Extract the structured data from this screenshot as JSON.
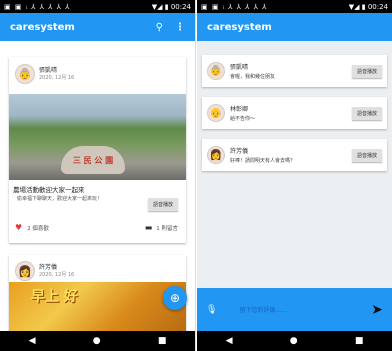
{
  "status": {
    "icons_left": "▣ ▣ ᵢ ⅄ ⅄ ⅄ ⅄ ⅄",
    "time": "00:24"
  },
  "app": {
    "title": "caresystem"
  },
  "feed": [
    {
      "user": "張凱晴",
      "date": "2020, 12月 16",
      "image_text": "三 民 公 園",
      "title": "農場活動歡迎大家一起來",
      "body": "偷幸福下聊聊天，歡迎大家一起來玩！",
      "voice_button": "語音播放",
      "likes": "2 個喜歡",
      "comments": "1 則留言"
    },
    {
      "user": "許芳儀",
      "date": "2020, 12月 16",
      "image_text": "早上 好"
    }
  ],
  "comments": [
    {
      "user": "張凱晴",
      "text": "會喔，我和幾位朋友",
      "button": "語音播放"
    },
    {
      "user": "林彰卿",
      "text": "給不告你～",
      "button": "語音播放"
    },
    {
      "user": "許芳儀",
      "text": "好棒！請問明天有人會去嗎？",
      "button": "語音播放"
    }
  ],
  "input": {
    "placeholder": "留下您的評論......"
  }
}
